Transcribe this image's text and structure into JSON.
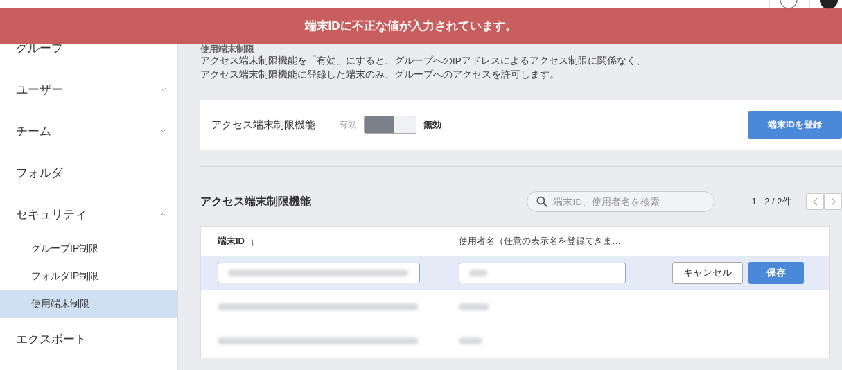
{
  "banner": {
    "message": "端末IDに不正な値が入力されています。"
  },
  "sidebar": {
    "items": [
      {
        "label": "グループ",
        "selected": false
      },
      {
        "label": "ユーザー",
        "selected": false,
        "expanded": false
      },
      {
        "label": "チーム",
        "selected": false,
        "expanded": false
      },
      {
        "label": "フォルダ",
        "selected": false
      },
      {
        "label": "セキュリティ",
        "selected": false,
        "expanded": true,
        "children": [
          {
            "label": "グループIP制限",
            "selected": false
          },
          {
            "label": "フォルダIP制限",
            "selected": false
          },
          {
            "label": "使用端末制限",
            "selected": true
          }
        ]
      },
      {
        "label": "エクスポート",
        "selected": false
      }
    ]
  },
  "page": {
    "heading": "使用端末制限",
    "description": [
      "アクセス端末制限機能を「有効」にすると、グループへのIPアドレスによるアクセス制限に関係なく、",
      "アクセス端末制限機能に登録した端末のみ、グループへのアクセスを許可します。"
    ]
  },
  "setting": {
    "label": "アクセス端末制限機能",
    "on_label": "有効",
    "off_label": "無効",
    "on": false,
    "register_button": "端末IDを登録"
  },
  "list": {
    "title": "アクセス端末制限機能",
    "search": {
      "placeholder": "端末ID、使用者名を検索"
    },
    "pagination": "1 - 2 / 2件",
    "columns": [
      {
        "label": "端末ID",
        "sort": "↓"
      },
      {
        "label": "使用者名（任意の表示名を登録できま…"
      }
    ],
    "rows": [
      {
        "kind": "edit",
        "cancel": "キャンセル",
        "save": "保存"
      },
      {
        "kind": "view"
      },
      {
        "kind": "view"
      }
    ]
  }
}
